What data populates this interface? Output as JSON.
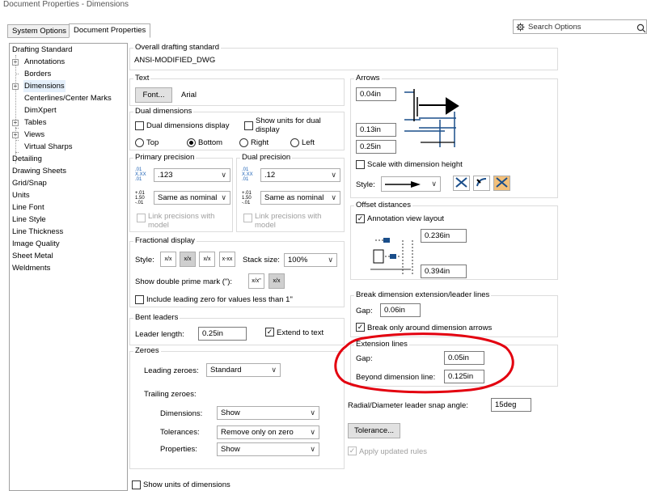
{
  "window": {
    "title": "Document Properties - Dimensions"
  },
  "tabs": [
    {
      "label": "System Options"
    },
    {
      "label": "Document Properties"
    }
  ],
  "search": {
    "placeholder": "Search Options"
  },
  "tree": {
    "items": [
      {
        "label": "Drafting Standard"
      },
      {
        "label": "Annotations"
      },
      {
        "label": "Borders"
      },
      {
        "label": "Dimensions"
      },
      {
        "label": "Centerlines/Center Marks"
      },
      {
        "label": "DimXpert"
      },
      {
        "label": "Tables"
      },
      {
        "label": "Views"
      },
      {
        "label": "Virtual Sharps"
      },
      {
        "label": "Detailing"
      },
      {
        "label": "Drawing Sheets"
      },
      {
        "label": "Grid/Snap"
      },
      {
        "label": "Units"
      },
      {
        "label": "Line Font"
      },
      {
        "label": "Line Style"
      },
      {
        "label": "Line Thickness"
      },
      {
        "label": "Image Quality"
      },
      {
        "label": "Sheet Metal"
      },
      {
        "label": "Weldments"
      }
    ]
  },
  "overall": {
    "label": "Overall drafting standard",
    "value": "ANSI-MODIFIED_DWG"
  },
  "text": {
    "label": "Text",
    "font_button": "Font...",
    "font_name": "Arial"
  },
  "dual": {
    "label": "Dual dimensions",
    "display_label": "Dual dimensions display",
    "show_units_label_1": "Show units for dual",
    "show_units_label_2": "display",
    "top": "Top",
    "bottom": "Bottom",
    "right": "Right",
    "left": "Left"
  },
  "primary_precision": {
    "label": "Primary precision",
    "value": ".123",
    "tol": "Same as nominal",
    "link_1": "Link precisions with",
    "link_2": "model"
  },
  "dual_precision": {
    "label": "Dual precision",
    "value": ".12",
    "tol": "Same as nominal",
    "link_1": "Link precisions with",
    "link_2": "model"
  },
  "precision_icons": {
    "value_glyph": ".01 X.XX .01",
    "tol_glyph": "+.01 1.50 -.01"
  },
  "fractional": {
    "label": "Fractional display",
    "style_label": "Style:",
    "stack_label": "Stack size:",
    "stack_value": "100%",
    "double_prime": "Show double prime mark (\"):",
    "leading_zero": "Include leading zero for values less than 1\"",
    "style_icons": [
      "x/x",
      "x/x",
      "x/x",
      "x-xx"
    ],
    "prime_icons": [
      "x/x\"",
      "x/x"
    ]
  },
  "bent": {
    "label": "Bent leaders",
    "length_label": "Leader length:",
    "length_value": "0.25in",
    "extend": "Extend to text"
  },
  "zeroes": {
    "label": "Zeroes",
    "leading_label": "Leading zeroes:",
    "leading_value": "Standard",
    "trailing_label": "Trailing zeroes:",
    "dimensions_label": "Dimensions:",
    "dimensions_value": "Show",
    "tolerances_label": "Tolerances:",
    "tolerances_value": "Remove only on zero",
    "properties_label": "Properties:",
    "properties_value": "Show"
  },
  "show_units": "Show units of dimensions",
  "arrows": {
    "label": "Arrows",
    "v1": "0.04in",
    "v2": "0.13in",
    "v3": "0.25in",
    "scale": "Scale with dimension height",
    "style_label": "Style:"
  },
  "offset": {
    "label": "Offset distances",
    "annotation_view": "Annotation view layout",
    "v1": "0.236in",
    "v2": "0.394in"
  },
  "break": {
    "label": "Break dimension extension/leader lines",
    "gap_label": "Gap:",
    "gap_value": "0.06in",
    "only_around": "Break only around dimension arrows"
  },
  "extension": {
    "label": "Extension lines",
    "gap_label": "Gap:",
    "gap_value": "0.05in",
    "beyond_label": "Beyond dimension line:",
    "beyond_value": "0.125in"
  },
  "radial": {
    "label": "Radial/Diameter leader snap angle:",
    "value": "15deg"
  },
  "tolerance_button": "Tolerance...",
  "apply_updated": "Apply updated rules",
  "colors": {
    "highlight_circle": "#e3000f",
    "selection_bg": "#e5f0fb"
  }
}
